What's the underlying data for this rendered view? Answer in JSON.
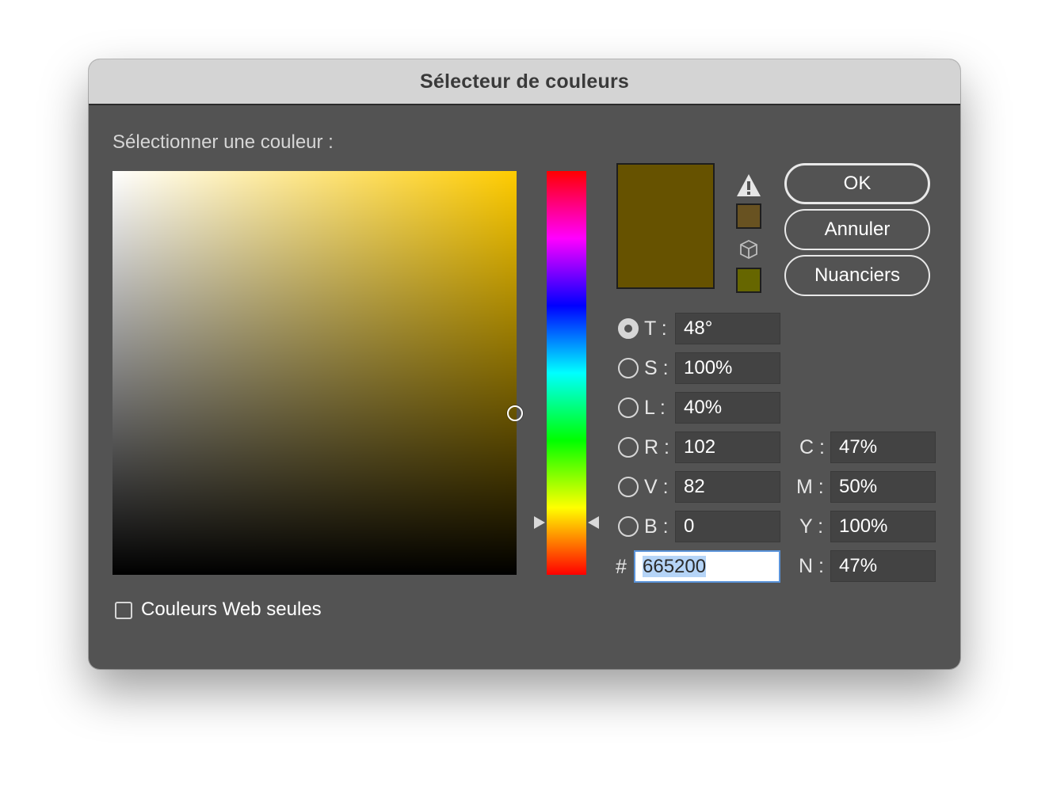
{
  "dialog": {
    "title": "Sélecteur de couleurs"
  },
  "picker": {
    "prompt": "Sélectionner une couleur :"
  },
  "colors": {
    "field_hue": "#ffcc00",
    "new_color": "#665200",
    "previous_color": "#665200",
    "gamut_chip": "#685221",
    "web_chip": "#666600"
  },
  "icons": {
    "warning": "out-of-gamut-warning-icon",
    "cube": "web-safe-cube-icon"
  },
  "buttons": {
    "ok": "OK",
    "cancel": "Annuler",
    "swatches": "Nuanciers"
  },
  "hsb": [
    {
      "key": "T :",
      "value": "48°",
      "checked": true
    },
    {
      "key": "S :",
      "value": "100%",
      "checked": false
    },
    {
      "key": "L :",
      "value": "40%",
      "checked": false
    }
  ],
  "rgb": [
    {
      "key": "R :",
      "value": "102",
      "checked": false
    },
    {
      "key": "V :",
      "value": "82",
      "checked": false
    },
    {
      "key": "B :",
      "value": "0",
      "checked": false
    }
  ],
  "cmyk": [
    {
      "key": "C :",
      "value": "47%"
    },
    {
      "key": "M :",
      "value": "50%"
    },
    {
      "key": "Y :",
      "value": "100%"
    },
    {
      "key": "N :",
      "value": "47%"
    }
  ],
  "hex": {
    "prefix": "#",
    "value": "665200"
  },
  "web_only": {
    "label": "Couleurs Web seules",
    "checked": false
  }
}
